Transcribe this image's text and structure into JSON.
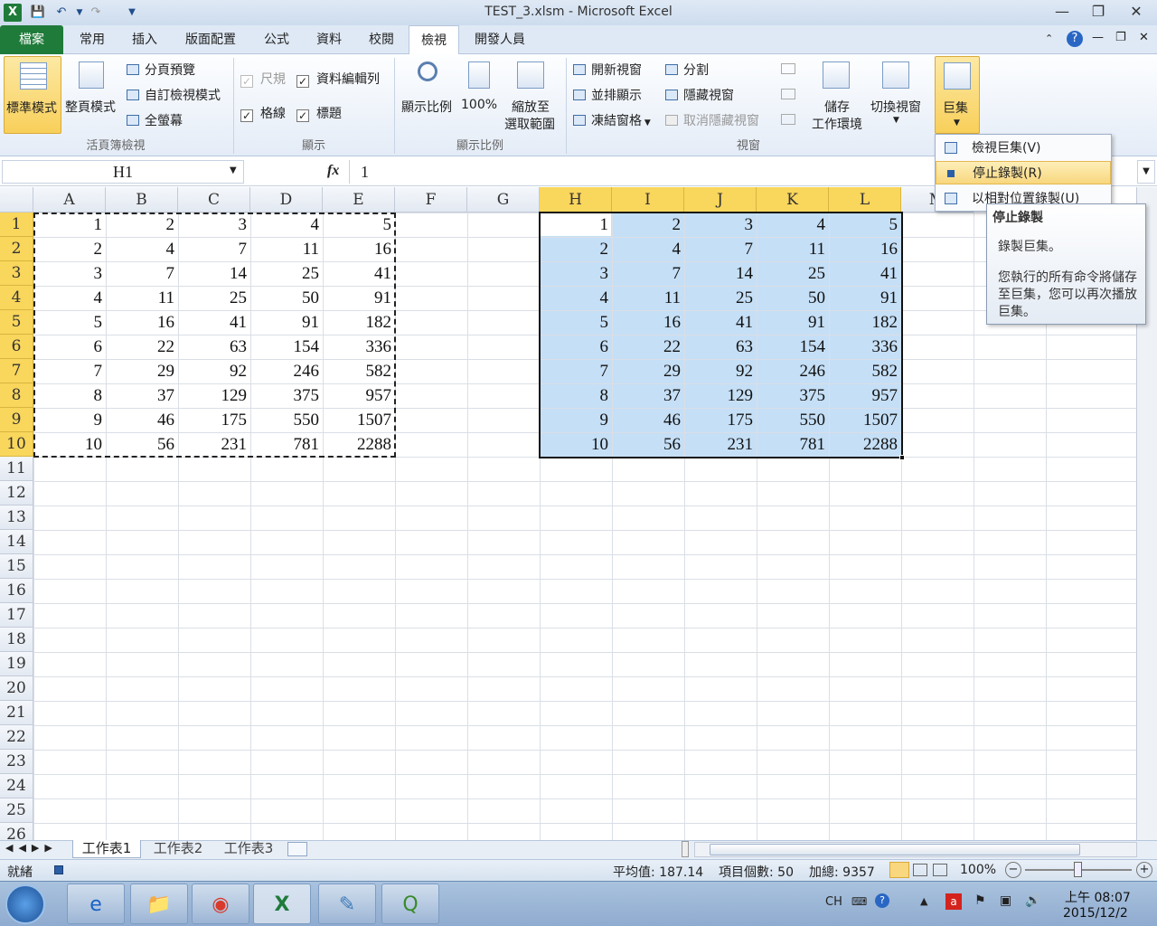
{
  "window": {
    "title": "TEST_3.xlsm  -  Microsoft Excel"
  },
  "tabs": [
    "檔案",
    "常用",
    "插入",
    "版面配置",
    "公式",
    "資料",
    "校閱",
    "檢視",
    "開發人員"
  ],
  "ribbon": {
    "workbook_views": {
      "normal": "標準模式",
      "page_layout": "整頁模式",
      "page_break": "分頁預覽",
      "custom_views": "自訂檢視模式",
      "full_screen": "全螢幕",
      "group": "活頁簿檢視"
    },
    "show": {
      "ruler": "尺規",
      "formula_bar": "資料編輯列",
      "gridlines": "格線",
      "headings": "標題",
      "group": "顯示"
    },
    "zoom": {
      "zoom": "顯示比例",
      "zoom100": "100%",
      "zoom_sel_1": "縮放至",
      "zoom_sel_2": "選取範圍",
      "group": "顯示比例"
    },
    "window": {
      "new_window": "開新視窗",
      "arrange": "並排顯示",
      "freeze": "凍結窗格",
      "split": "分割",
      "hide": "隱藏視窗",
      "unhide": "取消隱藏視窗",
      "save_ws_1": "儲存",
      "save_ws_2": "工作環境",
      "switch": "切換視窗",
      "group": "視窗"
    },
    "macros": {
      "label": "巨集"
    }
  },
  "formula_bar": {
    "name_box": "H1",
    "fx": "fx",
    "value": "1"
  },
  "columns": [
    "A",
    "B",
    "C",
    "D",
    "E",
    "F",
    "G",
    "H",
    "I",
    "J",
    "K",
    "L",
    "M"
  ],
  "rows": [
    "1",
    "2",
    "3",
    "4",
    "5",
    "6",
    "7",
    "8",
    "9",
    "10",
    "11",
    "12",
    "13",
    "14",
    "15",
    "16",
    "17",
    "18",
    "19",
    "20",
    "21",
    "22",
    "23",
    "24",
    "25",
    "26"
  ],
  "table_data": [
    [
      "1",
      "2",
      "3",
      "4",
      "5"
    ],
    [
      "2",
      "4",
      "7",
      "11",
      "16"
    ],
    [
      "3",
      "7",
      "14",
      "25",
      "41"
    ],
    [
      "4",
      "11",
      "25",
      "50",
      "91"
    ],
    [
      "5",
      "16",
      "41",
      "91",
      "182"
    ],
    [
      "6",
      "22",
      "63",
      "154",
      "336"
    ],
    [
      "7",
      "29",
      "92",
      "246",
      "582"
    ],
    [
      "8",
      "37",
      "129",
      "375",
      "957"
    ],
    [
      "9",
      "46",
      "175",
      "550",
      "1507"
    ],
    [
      "10",
      "56",
      "231",
      "781",
      "2288"
    ]
  ],
  "macro_menu": {
    "view": "檢視巨集(V)",
    "stop": "停止錄製(R)",
    "relative": "以相對位置錄製(U)"
  },
  "tooltip": {
    "title": "停止錄製",
    "line1": "錄製巨集。",
    "line2": "您執行的所有命令將儲存至巨集，您可以再次播放巨集。"
  },
  "sheets": [
    "工作表1",
    "工作表2",
    "工作表3"
  ],
  "status": {
    "ready": "就緒",
    "average": "平均值: 187.14",
    "count": "項目個數: 50",
    "sum": "加總: 9357",
    "zoom": "100%"
  },
  "taskbar": {
    "lang": "CH",
    "time": "上午 08:07",
    "date": "2015/12/2"
  },
  "colors": {
    "accent": "#f9d65c",
    "selection": "#c5dff6",
    "file_tab": "#1f7b3a"
  }
}
